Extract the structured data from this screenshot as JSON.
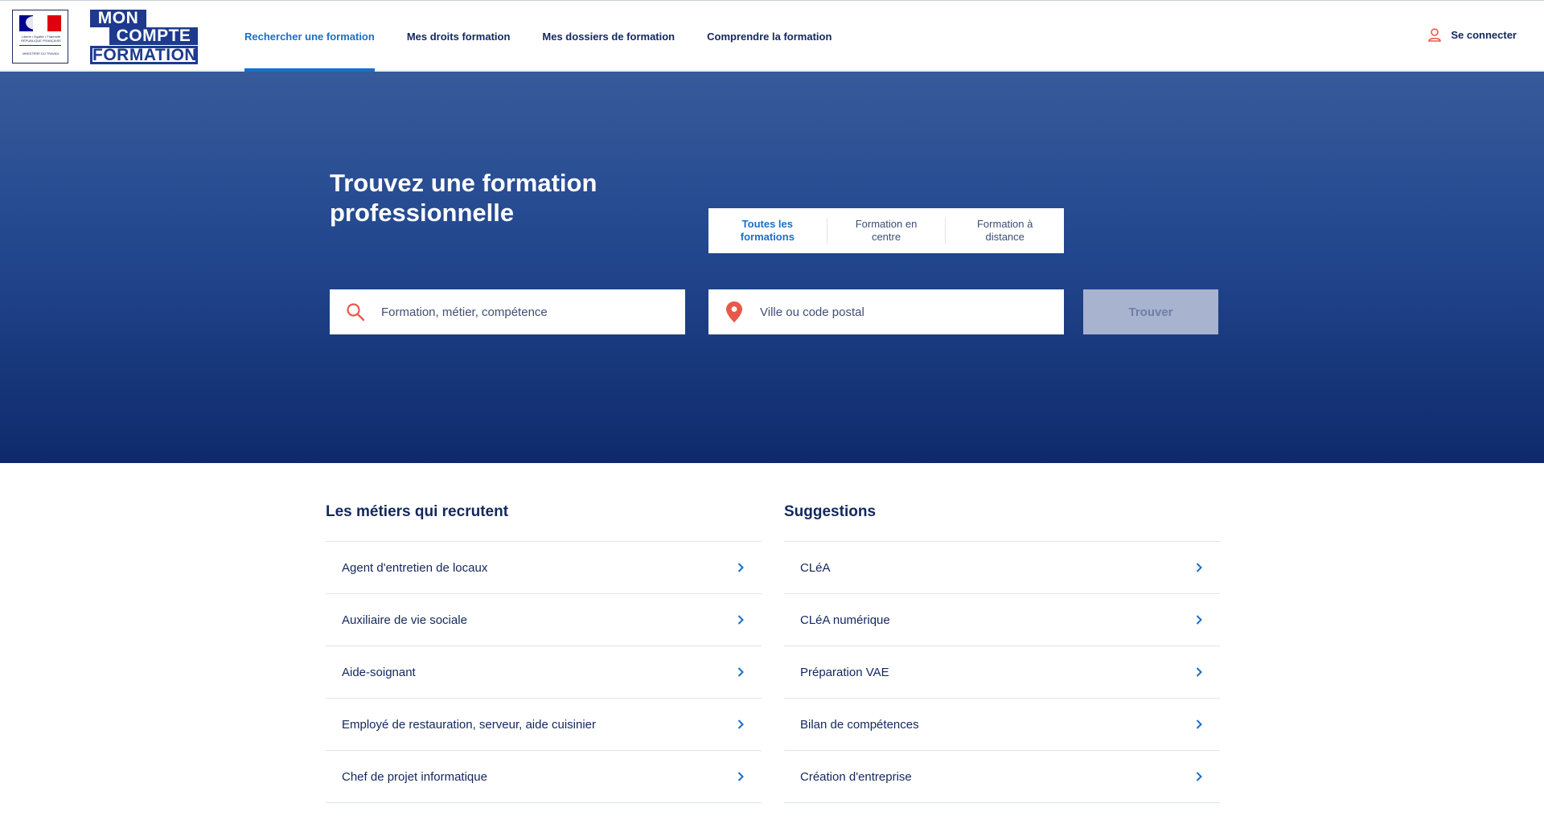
{
  "header": {
    "government_logo": {
      "motto": "Liberté • Égalité • Fraternité",
      "republic": "RÉPUBLIQUE FRANÇAISE",
      "ministry": "MINISTÈRE DU TRAVAIL",
      "flag_colors": [
        "#000091",
        "#ffffff",
        "#e1000f"
      ]
    },
    "brand_logo": {
      "line1": "MON",
      "line2": "COMPTE",
      "line3": "FORMATION",
      "color": "#1d3a8e"
    },
    "nav": [
      {
        "label": "Rechercher une formation",
        "active": true
      },
      {
        "label": "Mes droits formation",
        "active": false
      },
      {
        "label": "Mes dossiers de formation",
        "active": false
      },
      {
        "label": "Comprendre la formation",
        "active": false
      }
    ],
    "login": {
      "label": "Se connecter",
      "icon": "user-icon"
    }
  },
  "hero": {
    "title_line1": "Trouvez une formation",
    "title_line2": "professionnelle",
    "tabs": [
      {
        "label_line1": "Toutes les",
        "label_line2": "formations",
        "active": true
      },
      {
        "label_line1": "Formation en",
        "label_line2": "centre",
        "active": false
      },
      {
        "label_line1": "Formation à",
        "label_line2": "distance",
        "active": false
      }
    ],
    "search": {
      "placeholder": "Formation, métier, compétence",
      "value": "",
      "icon": "search-icon"
    },
    "location": {
      "placeholder": "Ville ou code postal",
      "value": "",
      "icon": "location-pin-icon"
    },
    "submit_label": "Trouver"
  },
  "lists": {
    "jobs": {
      "title": "Les métiers qui recrutent",
      "items": [
        "Agent d'entretien de locaux",
        "Auxiliaire de vie sociale",
        "Aide-soignant",
        "Employé de restauration, serveur, aide cuisinier",
        "Chef de projet informatique"
      ]
    },
    "suggestions": {
      "title": "Suggestions",
      "items": [
        "CLéA",
        "CLéA numérique",
        "Préparation VAE",
        "Bilan de compétences",
        "Création d'entreprise"
      ]
    }
  },
  "colors": {
    "primary": "#1a6fc9",
    "navy": "#12275d",
    "accent_icon": "#e8584a",
    "hero_top": "#365a9a",
    "hero_bottom": "#0e2a6c",
    "button_disabled": "#a8b3cf"
  }
}
